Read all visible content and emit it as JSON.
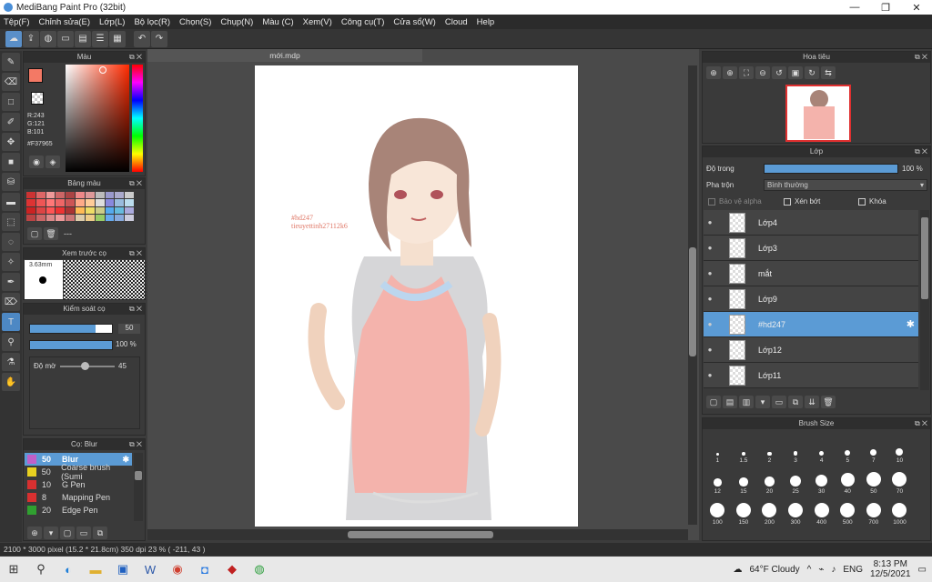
{
  "app": {
    "title": "MediBang Paint Pro (32bit)"
  },
  "menu": [
    "Tệp(F)",
    "Chỉnh sửa(E)",
    "Lớp(L)",
    "Bộ lọc(R)",
    "Chọn(S)",
    "Chụp(N)",
    "Màu (C)",
    "Xem(V)",
    "Công cụ(T)",
    "Cửa sổ(W)",
    "Cloud",
    "Help"
  ],
  "color_panel": {
    "title": "Màu",
    "r": "R:243",
    "g": "G:121",
    "b": "B:101",
    "hex": "#F37965",
    "main_color": "#F37965"
  },
  "palette_panel": {
    "title": "Bảng màu",
    "dash": "---"
  },
  "preview_panel": {
    "title": "Xem trước cọ",
    "size": "3.63mm"
  },
  "brush_control": {
    "title": "Kiểm soát cọ",
    "size_value": "50",
    "opacity_value": "100 %",
    "blur_label": "Độ mờ",
    "blur_value": "45",
    "size_fill": 0.8,
    "opacity_fill": 1.0,
    "blur_fill": 0.45
  },
  "brush_list": {
    "title": "Cọ: Blur",
    "items": [
      {
        "size": "50",
        "name": "Blur",
        "color": "#c060c8",
        "selected": true
      },
      {
        "size": "50",
        "name": "Coarse brush (Sumi",
        "color": "#e8d020",
        "selected": false
      },
      {
        "size": "10",
        "name": "G Pen",
        "color": "#d83030",
        "selected": false
      },
      {
        "size": "8",
        "name": "Mapping Pen",
        "color": "#d83030",
        "selected": false
      },
      {
        "size": "20",
        "name": "Edge Pen",
        "color": "#30a030",
        "selected": false
      }
    ]
  },
  "document": {
    "tab": "mới.mdp",
    "watermark_line1": "#hd247",
    "watermark_line2": "tieuyettinh27112k6"
  },
  "navigator": {
    "title": "Hoa tiêu"
  },
  "layer_panel": {
    "title": "Lớp",
    "opacity_label": "Độ trong",
    "opacity_value": "100 %",
    "opacity_fill": 1.0,
    "blend_label": "Pha trộn",
    "blend_value": "Bình thường",
    "protect_alpha": "Bảo vệ alpha",
    "clipping": "Xén bớt",
    "lock": "Khóa",
    "layers": [
      {
        "name": "Lớp4",
        "selected": false
      },
      {
        "name": "Lớp3",
        "selected": false
      },
      {
        "name": "mắt",
        "selected": false
      },
      {
        "name": "Lớp9",
        "selected": false
      },
      {
        "name": "#hd247",
        "selected": true
      },
      {
        "name": "Lớp12",
        "selected": false
      },
      {
        "name": "Lớp11",
        "selected": false
      }
    ]
  },
  "brush_size": {
    "title": "Brush Size",
    "sizes": [
      "1",
      "1.5",
      "2",
      "3",
      "4",
      "5",
      "7",
      "10",
      "12",
      "15",
      "20",
      "25",
      "30",
      "40",
      "50",
      "70",
      "100",
      "150",
      "200",
      "300",
      "400",
      "500",
      "700",
      "1000"
    ]
  },
  "status": {
    "text": "2100 * 3000 pixel   (15.2 * 21.8cm)   350 dpi   23 %   ( -211, 43 )"
  },
  "taskbar": {
    "weather": "64°F  Cloudy",
    "lang": "ENG",
    "time": "8:13 PM",
    "date": "12/5/2021"
  }
}
